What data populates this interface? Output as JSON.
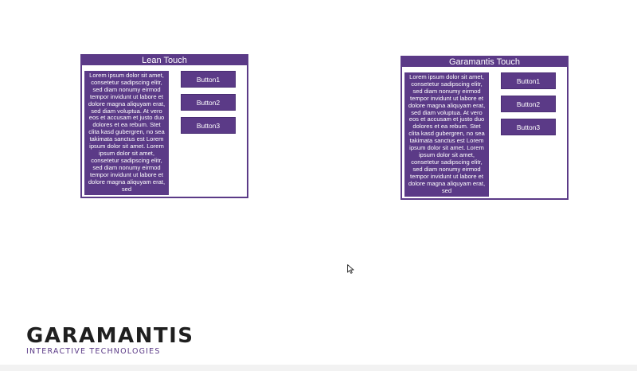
{
  "panels": {
    "left": {
      "title": "Lean Touch",
      "text": "Lorem ipsum dolor sit amet, consetetur sadipscing elitr, sed diam nonumy eirmod tempor invidunt ut labore et dolore magna aliquyam erat, sed diam voluptua. At vero eos et accusam et justo duo dolores et ea rebum. Stet clita kasd gubergren, no sea takimata sanctus est Lorem ipsum dolor sit amet. Lorem ipsum dolor sit amet, consetetur sadipscing elitr, sed diam nonumy eirmod tempor invidunt ut labore et dolore magna aliquyam erat, sed",
      "buttons": [
        "Button1",
        "Button2",
        "Button3"
      ]
    },
    "right": {
      "title": "Garamantis Touch",
      "text": "Lorem ipsum dolor sit amet, consetetur sadipscing elitr, sed diam nonumy eirmod tempor invidunt ut labore et dolore magna aliquyam erat, sed diam voluptua. At vero eos et accusam et justo duo dolores et ea rebum. Stet clita kasd gubergren, no sea takimata sanctus est Lorem ipsum dolor sit amet. Lorem ipsum dolor sit amet, consetetur sadipscing elitr, sed diam nonumy eirmod tempor invidunt ut labore et dolore magna aliquyam erat, sed",
      "buttons": [
        "Button1",
        "Button2",
        "Button3"
      ]
    }
  },
  "logo": {
    "wordmark": "GARAMANTIS",
    "tagline": "INTERACTIVE TECHNOLOGIES"
  },
  "colors": {
    "accent": "#5b3a87",
    "wordmark": "#1f1f1f",
    "background": "#ffffff"
  },
  "icons": {
    "cursor": "mouse-pointer-icon"
  }
}
